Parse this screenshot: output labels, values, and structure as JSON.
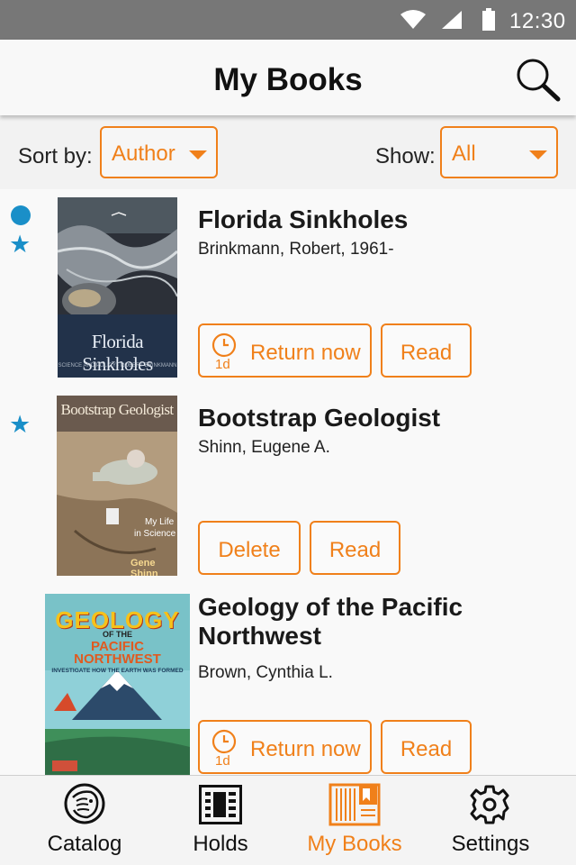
{
  "status_bar": {
    "time": "12:30"
  },
  "app_bar": {
    "title": "My Books"
  },
  "filters": {
    "sort_label": "Sort by:",
    "sort_value": "Author",
    "show_label": "Show:",
    "show_value": "All"
  },
  "books": [
    {
      "title": "Florida Sinkholes",
      "author": "Brinkmann, Robert, 1961-",
      "cover_title": "Florida Sinkholes",
      "cover_subtitle": "SCIENCE AND POLICY · ROBERT BRINKMANN",
      "unread_dot": true,
      "starred": true,
      "buttons": {
        "return_label": "Return now",
        "return_days": "1d",
        "read_label": "Read"
      }
    },
    {
      "title": "Bootstrap Geologist",
      "author": "Shinn, Eugene A.",
      "cover_title": "Bootstrap Geologist",
      "cover_subtitle_1": "My Life",
      "cover_subtitle_2": "in Science",
      "cover_author": "Gene Shinn",
      "unread_dot": false,
      "starred": true,
      "buttons": {
        "delete_label": "Delete",
        "read_label": "Read"
      }
    },
    {
      "title": "Geology of the Pacific Northwest",
      "author": "Brown, Cynthia L.",
      "cover_title_1": "GEOLOGY",
      "cover_title_2": "OF THE",
      "cover_title_3": "PACIFIC",
      "cover_title_4": "NORTHWEST",
      "cover_tagline": "INVESTIGATE HOW THE EARTH WAS FORMED",
      "unread_dot": false,
      "starred": false,
      "buttons": {
        "return_label": "Return now",
        "return_days": "1d",
        "read_label": "Read"
      }
    }
  ],
  "bottom_nav": {
    "items": [
      {
        "label": "Catalog",
        "icon": "lion-logo-icon",
        "active": false
      },
      {
        "label": "Holds",
        "icon": "holds-list-icon",
        "active": false
      },
      {
        "label": "My Books",
        "icon": "bookshelf-icon",
        "active": true
      },
      {
        "label": "Settings",
        "icon": "gear-icon",
        "active": false
      }
    ]
  },
  "colors": {
    "accent": "#f0801a",
    "indicator": "#1a8fc8",
    "status_bar": "#777777"
  }
}
